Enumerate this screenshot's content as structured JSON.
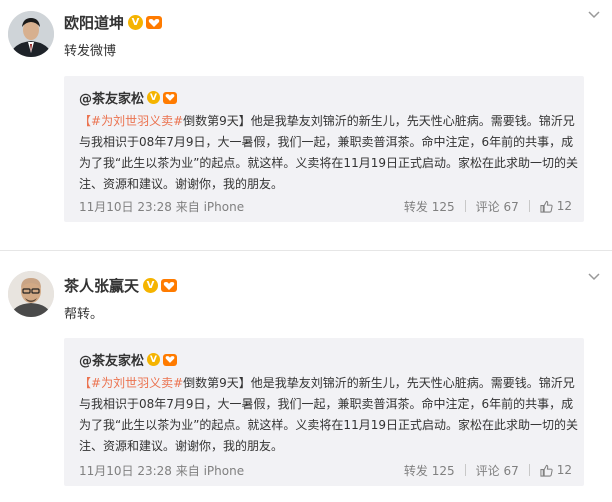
{
  "posts": [
    {
      "author": "欧阳道坤",
      "text": "转发微博",
      "badge_v": "V",
      "repost": {
        "author": "@茶友家松",
        "topic": "#为刘世羽义卖#",
        "body": "倒数第9天】他是我挚友刘锦沂的新生儿，先天性心脏病。需要钱。锦沂兄与我相识于08年7月9日，大一暑假，我们一起，兼职卖普洱茶。命中注定，6年前的共事，成为了我“此生以茶为业”的起点。就这样。义卖将在11月19日正式启动。家松在此求助一切的关注、资源和建议。谢谢你，我的朋友。",
        "bracket_open": "【",
        "time": "11月10日 23:28 来自 iPhone",
        "repost_count": "转发 125",
        "comment_count": "评论 67",
        "like_count": "12"
      }
    },
    {
      "author": "茶人张赢天",
      "text": "帮转。",
      "badge_v": "V",
      "repost": {
        "author": "@茶友家松",
        "topic": "#为刘世羽义卖#",
        "body": "倒数第9天】他是我挚友刘锦沂的新生儿，先天性心脏病。需要钱。锦沂兄与我相识于08年7月9日，大一暑假，我们一起，兼职卖普洱茶。命中注定，6年前的共事，成为了我“此生以茶为业”的起点。就这样。义卖将在11月19日正式启动。家松在此求助一切的关注、资源和建议。谢谢你，我的朋友。",
        "bracket_open": "【",
        "time": "11月10日 23:28 来自 iPhone",
        "repost_count": "转发 125",
        "comment_count": "评论 67",
        "like_count": "12"
      }
    }
  ],
  "icons": {
    "verified": "verified-v-badge-icon",
    "level": "member-level-icon",
    "menu": "chevron-down-icon",
    "like": "thumbs-up-icon"
  },
  "colors": {
    "topic": "#eb7350",
    "verified": "#f5b400",
    "repost_bg": "#f2f2f5"
  }
}
